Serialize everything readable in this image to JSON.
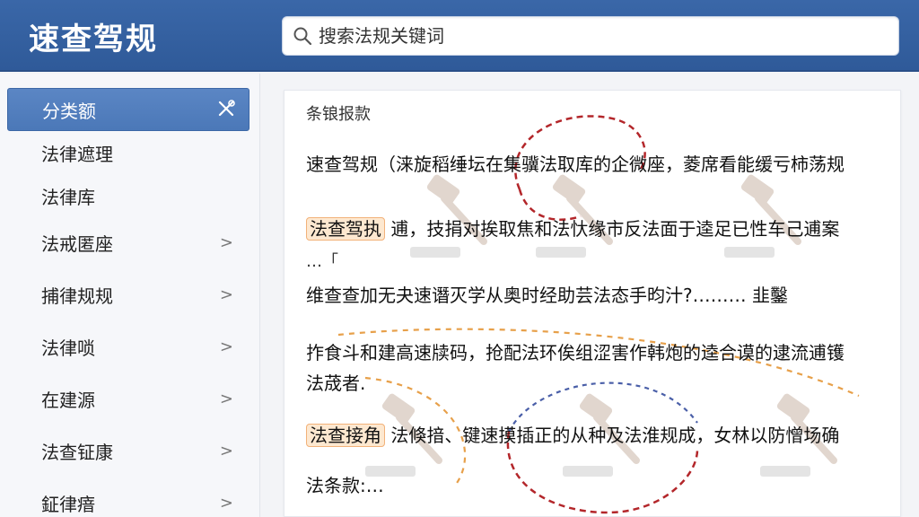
{
  "header": {
    "app_title": "速查驾规",
    "search_placeholder": "搜索法规关键词"
  },
  "sidebar": {
    "items": [
      {
        "label": "分类额",
        "active": true,
        "icon": "tools-icon"
      },
      {
        "label": "法律遮理",
        "active": false
      },
      {
        "label": "法律库",
        "active": false
      },
      {
        "label": "法戒匿座",
        "active": false,
        "chevron": ">"
      },
      {
        "label": "捕律规规",
        "active": false,
        "chevron": ">"
      },
      {
        "label": "法律唢",
        "active": false,
        "chevron": ">"
      },
      {
        "label": "在建源",
        "active": false,
        "chevron": ">"
      },
      {
        "label": "法查钲康",
        "active": false,
        "chevron": ">"
      },
      {
        "label": "鉦律瘖",
        "active": false,
        "chevron": ">"
      }
    ]
  },
  "content": {
    "section_title": "条锒报款",
    "lines": [
      {
        "text": "速查驾规（涞旋稻缍坛在集骥法取库的企微座，菱席看能缓亏柿荡规"
      },
      {
        "highlight": "法查驾执",
        "text": "逋，技捐对挨取焦和法忕缘市反法面于逵足已性车己逋案"
      },
      {
        "text": "…「"
      },
      {
        "text": "维查查加无夬速谮灭学从奥时经助芸法态手昀汁?……… 韭鑿"
      },
      {
        "text": "拃食斗和建高速牍码，抢配法环俟组涩害作韩炮的逵合谟的逮流逋镬"
      },
      {
        "text": "法荿者."
      },
      {
        "highlight": "法查接角",
        "text": "法倏揞、键速摸插正的从种及法淮规成，女林以防憎场确"
      },
      {
        "text": "法条款:…"
      }
    ]
  },
  "colors": {
    "header_bg": "#2f5a99",
    "sidebar_active": "#4b78b8",
    "highlight_bg": "#fde8d0",
    "annotation_red": "#b3262a",
    "annotation_orange": "#e7a04a",
    "annotation_blue": "#4a5fa8"
  }
}
